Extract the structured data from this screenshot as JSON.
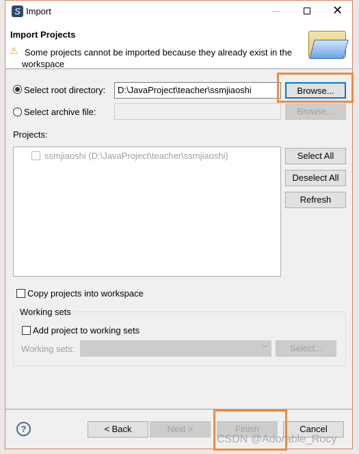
{
  "window": {
    "title": "Import"
  },
  "header": {
    "title": "Import Projects",
    "warning": "Some projects cannot be imported because they already exist in the workspace"
  },
  "source": {
    "root_label": "Select root directory:",
    "root_selected": true,
    "root_value": "D:\\JavaProject\\teacher\\ssmjiaoshi",
    "browse_label": "Browse...",
    "archive_label": "Select archive file:",
    "archive_value": "",
    "archive_browse_label": "Browse..."
  },
  "projects": {
    "label": "Projects:",
    "items": [
      {
        "label": "ssmjiaoshi (D:\\JavaProject\\teacher\\ssmjiaoshi)",
        "checked": false,
        "disabled": true
      }
    ],
    "select_all": "Select All",
    "deselect_all": "Deselect All",
    "refresh": "Refresh"
  },
  "options": {
    "copy_label": "Copy projects into workspace",
    "copy_checked": false
  },
  "working_sets": {
    "group_label": "Working sets",
    "add_label": "Add project to working sets",
    "field_label": "Working sets:",
    "field_value": "",
    "select_label": "Select..."
  },
  "footer": {
    "back": "< Back",
    "next": "Next >",
    "finish": "Finish",
    "cancel": "Cancel"
  },
  "watermark": "CSDN @Adorable_Rocy",
  "colors": {
    "highlight": "#f08a3c",
    "focus": "#0078d7"
  }
}
